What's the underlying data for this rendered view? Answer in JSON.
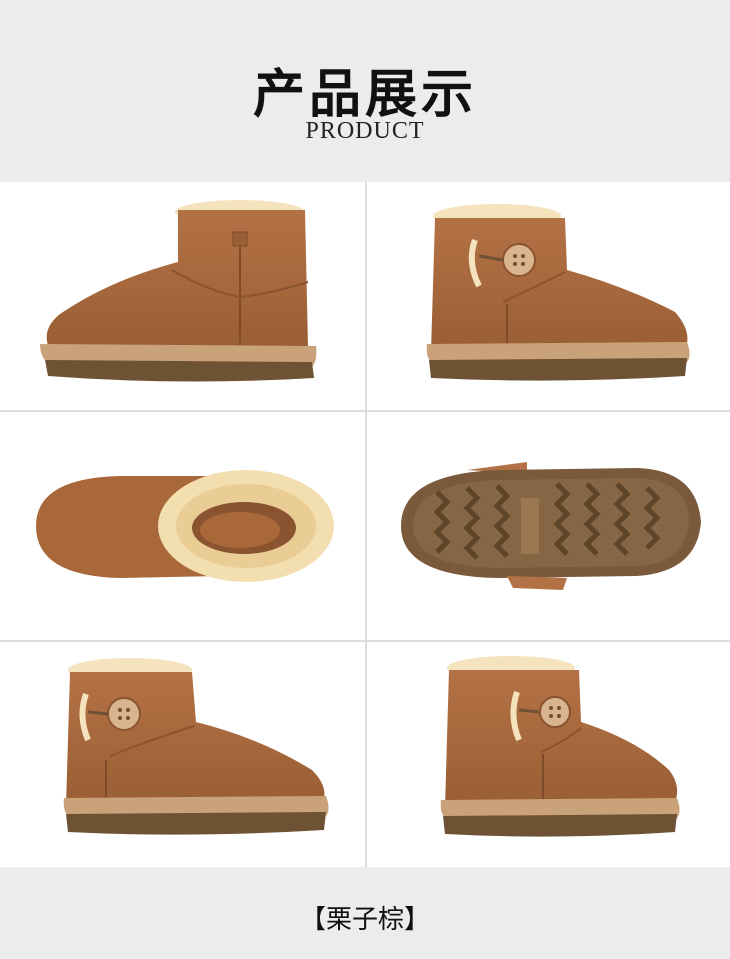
{
  "header": {
    "title_cn": "产品展示",
    "title_en": "PRODUCT"
  },
  "gallery": {
    "photos": [
      {
        "view": "side-view-left"
      },
      {
        "view": "side-view-button"
      },
      {
        "view": "top-view-fur-lining"
      },
      {
        "view": "sole-view"
      },
      {
        "view": "angle-view-button-left"
      },
      {
        "view": "angle-view-button-right"
      }
    ]
  },
  "footer": {
    "color_label": "【栗子棕】"
  },
  "colors": {
    "suede": "#a8683a",
    "suede_dark": "#8a5430",
    "fur": "#f3deb0",
    "sole": "#6e5234",
    "background": "#ececec"
  }
}
